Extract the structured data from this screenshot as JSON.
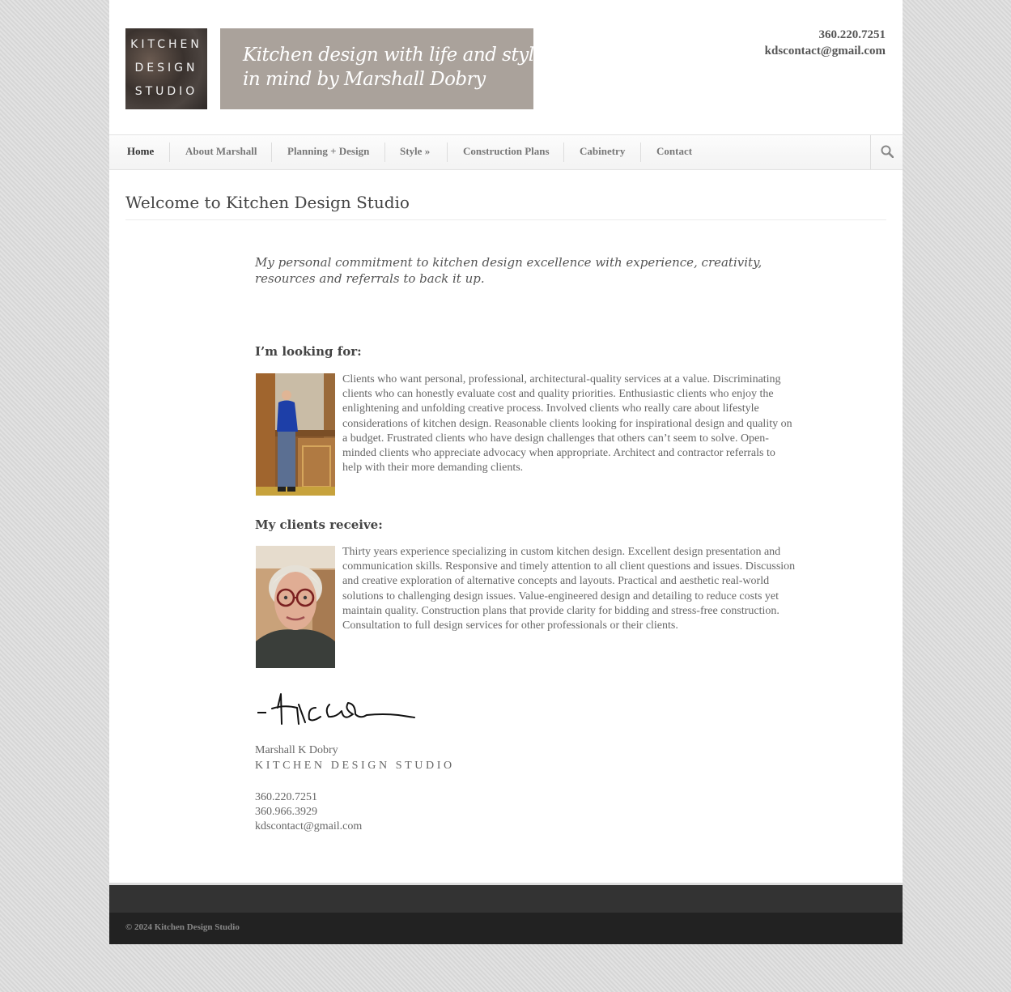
{
  "header": {
    "logo_lines": [
      "KITCHEN",
      "DESIGN",
      "STUDIO"
    ],
    "tagline_lines": [
      "Kitchen design with life and style",
      "in mind by Marshall Dobry"
    ],
    "phone": "360.220.7251",
    "email": "kdscontact@gmail.com"
  },
  "nav": {
    "items": [
      {
        "label": "Home"
      },
      {
        "label": "About Marshall"
      },
      {
        "label": "Planning + Design"
      },
      {
        "label": "Style »"
      },
      {
        "label": "Construction Plans"
      },
      {
        "label": "Cabinetry"
      },
      {
        "label": "Contact"
      }
    ],
    "search_icon": "search-icon"
  },
  "main": {
    "title": "Welcome to Kitchen Design Studio",
    "intro": "My personal commitment to kitchen design excellence with experience, creativity, resources and referrals to back it up.",
    "looking_heading": "I’m looking for:",
    "looking_text": "Clients who want personal, professional, architectural-quality services at a value. Discriminating clients who can honestly evaluate cost and quality priorities. Enthusiastic clients who enjoy the enlightening and unfolding creative process. Involved clients who really care about lifestyle considerations of kitchen design. Reasonable clients looking for inspirational design and quality on a budget. Frustrated clients who have design challenges that others can’t seem to solve. Open-minded clients who appreciate advocacy when appropriate. Architect and contractor referrals to help with their more demanding clients.",
    "receive_heading": "My clients receive:",
    "receive_text": "Thirty years experience specializing in custom kitchen design. Excellent design presentation and communication skills. Responsive and timely attention to all client questions and issues. Discussion and creative exploration of alternative concepts and layouts. Practical and aesthetic real-world solutions to challenging design issues. Value-engineered design and detailing to reduce costs yet maintain quality. Construction plans that provide clarity for bidding and stress-free construction. Consultation to full design services for other professionals or their clients.",
    "signature_name": "Marshall K Dobry",
    "signature_studio": "KITCHEN DESIGN STUDIO",
    "phone1": "360.220.7251",
    "phone2": "360.966.3929",
    "email": "kdscontact@gmail.com"
  },
  "footer": {
    "copyright": "© 2024 Kitchen Design Studio"
  }
}
